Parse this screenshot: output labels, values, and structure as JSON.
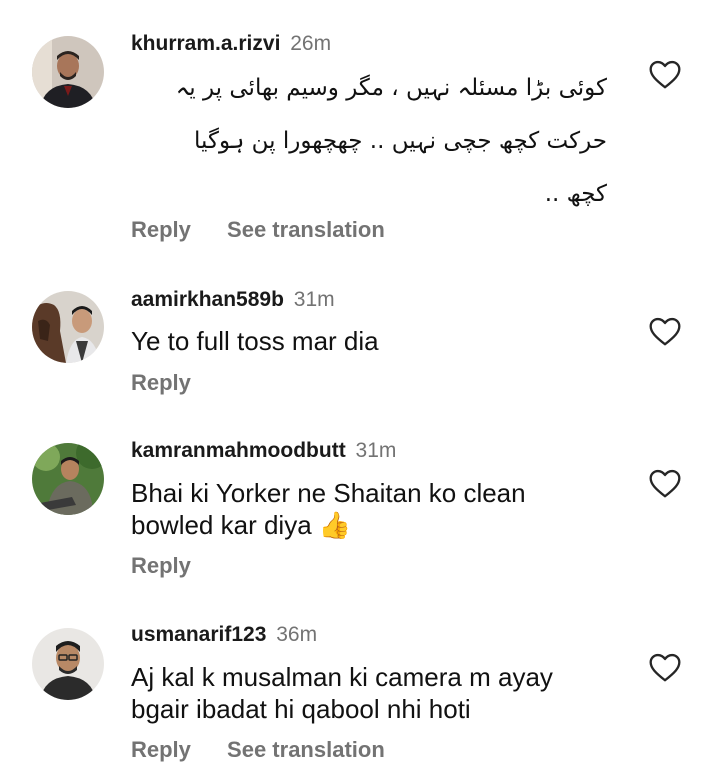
{
  "comments": [
    {
      "username": "khurram.a.rizvi",
      "time": "26m",
      "text_lines": [
        "کوئی بڑا مسئلہ نہیں ، مگر وسیم بھائی پر یہ",
        "حرکت کچھ جچی نہیں .. چھچھورا پن ہوگیا",
        "کچھ .."
      ],
      "reply": "Reply",
      "see_translation": "See translation"
    },
    {
      "username": "aamirkhan589b",
      "time": "31m",
      "text_lines": [
        "Ye to full toss mar dia"
      ],
      "reply": "Reply"
    },
    {
      "username": "kamranmahmoodbutt",
      "time": "31m",
      "text_lines": [
        "Bhai ki Yorker ne Shaitan ko clean",
        "bowled kar diya 👍"
      ],
      "reply": "Reply"
    },
    {
      "username": "usmanarif123",
      "time": "36m",
      "text_lines": [
        "Aj kal k musalman ki camera m ayay",
        "bgair ibadat hi qabool nhi hoti"
      ],
      "reply": "Reply",
      "see_translation": "See translation"
    }
  ],
  "icons": {
    "like": "heart-outline-icon"
  },
  "colors": {
    "username": "#1a1a1a",
    "secondary": "#737373",
    "text": "#111111"
  }
}
